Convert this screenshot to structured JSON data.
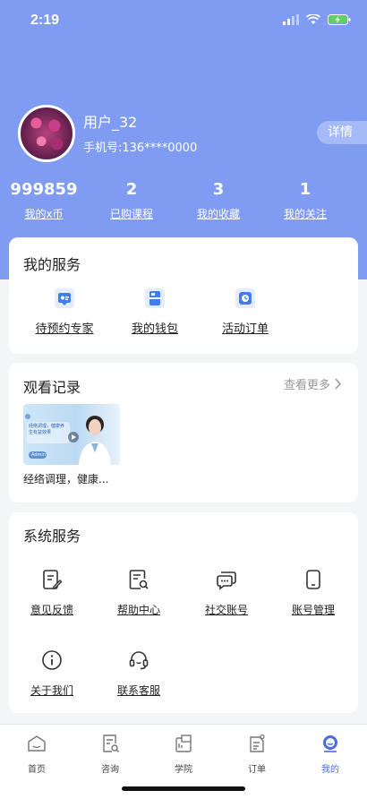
{
  "status_bar": {
    "time": "2:19"
  },
  "profile": {
    "username": "用户_32",
    "phone": "手机号:136****0000",
    "detail_label": "详情"
  },
  "stats": [
    {
      "value": "999859",
      "label": "我的x币"
    },
    {
      "value": "2",
      "label": "已购课程"
    },
    {
      "value": "3",
      "label": "我的收藏"
    },
    {
      "value": "1",
      "label": "我的关注"
    }
  ],
  "my_services": {
    "title": "我的服务",
    "items": [
      {
        "label": "待预约专家",
        "icon": "expert-icon"
      },
      {
        "label": "我的钱包",
        "icon": "wallet-icon"
      },
      {
        "label": "活动订单",
        "icon": "order-icon"
      }
    ]
  },
  "history": {
    "title": "观看记录",
    "more_label": "查看更多",
    "items": [
      {
        "title": "经络调理，健康...",
        "thumb_text": "经络调理，健康养生有益效果",
        "thumb_badge": "Admin"
      }
    ]
  },
  "system_services": {
    "title": "系统服务",
    "items": [
      {
        "label": "意见反馈",
        "icon": "feedback-icon"
      },
      {
        "label": "帮助中心",
        "icon": "help-center-icon"
      },
      {
        "label": "社交账号",
        "icon": "social-account-icon"
      },
      {
        "label": "账号管理",
        "icon": "account-manage-icon"
      },
      {
        "label": "关于我们",
        "icon": "info-icon"
      },
      {
        "label": "联系客服",
        "icon": "headset-icon"
      }
    ]
  },
  "tabbar": {
    "items": [
      {
        "label": "首页",
        "icon": "home-icon"
      },
      {
        "label": "咨询",
        "icon": "consult-icon"
      },
      {
        "label": "学院",
        "icon": "academy-icon"
      },
      {
        "label": "订单",
        "icon": "orders-icon"
      },
      {
        "label": "我的",
        "icon": "profile-icon",
        "active": true
      }
    ]
  },
  "colors": {
    "header": "#7f9cf2",
    "accent": "#4a6ee0",
    "icon_blue": "#3f7ef0"
  }
}
